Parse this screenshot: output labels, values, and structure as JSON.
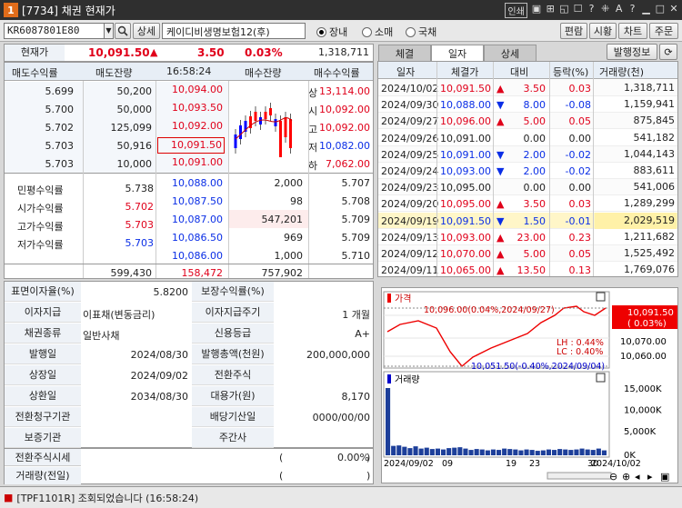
{
  "window": {
    "number": "1",
    "title": "[7734] 채권 현재가",
    "icons": [
      "인쇄",
      "▣",
      "⊞",
      "◱",
      "☐",
      "?",
      "⁜",
      "A",
      "?",
      "▁",
      "□",
      "✕"
    ]
  },
  "toolbar": {
    "code": "KR6087801E80",
    "detail": "상세",
    "bond_name": "케이디비생명보험12(후)",
    "radios": [
      "장내",
      "소매",
      "국채"
    ],
    "selected": 0,
    "buttons": [
      "편람",
      "시황",
      "차트",
      "주문"
    ]
  },
  "price_row": {
    "label": "현재가",
    "price": "10,091.50",
    "arrow": "▲",
    "change": "3.50",
    "pct": "0.03%",
    "volume": "1,318,711"
  },
  "quote": {
    "headers": [
      "매도수익률",
      "매도잔량",
      "16:58:24",
      "매수잔량",
      "매수수익률"
    ],
    "ask": [
      {
        "yield": "5.699",
        "qty": "50,200",
        "price": "10,094.00"
      },
      {
        "yield": "5.700",
        "qty": "50,000",
        "price": "10,093.50"
      },
      {
        "yield": "5.702",
        "qty": "125,099",
        "price": "10,092.00"
      },
      {
        "yield": "5.703",
        "qty": "50,916",
        "price": "10,091.50"
      },
      {
        "yield": "5.703",
        "qty": "10,000",
        "price": "10,091.00"
      }
    ],
    "bid": [
      {
        "price": "10,088.00",
        "qty": "2,000",
        "yield": "5.707"
      },
      {
        "price": "10,087.50",
        "qty": "98",
        "yield": "5.708"
      },
      {
        "price": "10,087.00",
        "qty": "547,201",
        "yield": "5.709"
      },
      {
        "price": "10,086.50",
        "qty": "969",
        "yield": "5.709"
      },
      {
        "price": "10,086.00",
        "qty": "1,000",
        "yield": "5.710"
      }
    ],
    "limits": [
      {
        "k": "상",
        "v": "13,114.00"
      },
      {
        "k": "시",
        "v": "10,092.00"
      },
      {
        "k": "고",
        "v": "10,092.00"
      },
      {
        "k": "저",
        "v": "10,082.00"
      },
      {
        "k": "하",
        "v": "7,062.00"
      }
    ],
    "stats": [
      {
        "k": "민평수익률",
        "v": "5.738"
      },
      {
        "k": "시가수익률",
        "v": "5.702"
      },
      {
        "k": "고가수익률",
        "v": "5.703"
      },
      {
        "k": "저가수익률",
        "v": "5.703"
      }
    ],
    "totals": {
      "ask_qty": "599,430",
      "diff": "158,472",
      "bid_qty": "757,902"
    }
  },
  "info": [
    [
      "표면이자율(%)",
      "5.8200",
      "보장수익률(%)",
      ""
    ],
    [
      "이자지급",
      "이표채(변동금리)",
      "이자지급주기",
      "1 개월"
    ],
    [
      "채권종류",
      "일반사채",
      "신용등급",
      "A+"
    ],
    [
      "발행일",
      "2024/08/30",
      "발행총액(천원)",
      "200,000,000"
    ],
    [
      "상장일",
      "2024/09/02",
      "전환주식",
      ""
    ],
    [
      "상환일",
      "2034/08/30",
      "대용가(원)",
      "8,170"
    ],
    [
      "전환청구기관",
      "",
      "배당기산일",
      "0000/00/00"
    ],
    [
      "보증기관",
      "",
      "주간사",
      ""
    ]
  ],
  "bottom": {
    "conv": "전환주식시세",
    "conv_paren": "(",
    "conv_pct": "0.00%",
    "conv_close": ")",
    "vol": "거래량(전일)",
    "vol_paren": "(",
    "vol_close": ")"
  },
  "right_tabs": {
    "tabs": [
      "체결",
      "일자",
      "상세"
    ],
    "active": 1,
    "btn": "발행정보"
  },
  "daily": {
    "headers": [
      "일자",
      "체결가",
      "대비",
      "등락(%)",
      "거래량(천)"
    ],
    "rows": [
      {
        "d": "2024/10/02",
        "p": "10,091.50",
        "pc": "red",
        "a": "▲",
        "c": "3.50",
        "r": "0.03",
        "v": "1,318,711"
      },
      {
        "d": "2024/09/30",
        "p": "10,088.00",
        "pc": "blue",
        "a": "▼",
        "c": "8.00",
        "r": "-0.08",
        "v": "1,159,941"
      },
      {
        "d": "2024/09/27",
        "p": "10,096.00",
        "pc": "red",
        "a": "▲",
        "c": "5.00",
        "r": "0.05",
        "v": "875,845"
      },
      {
        "d": "2024/09/26",
        "p": "10,091.00",
        "pc": "black",
        "a": "",
        "c": "0.00",
        "r": "0.00",
        "v": "541,182"
      },
      {
        "d": "2024/09/25",
        "p": "10,091.00",
        "pc": "blue",
        "a": "▼",
        "c": "2.00",
        "r": "-0.02",
        "v": "1,044,143"
      },
      {
        "d": "2024/09/24",
        "p": "10,093.00",
        "pc": "blue",
        "a": "▼",
        "c": "2.00",
        "r": "-0.02",
        "v": "883,611"
      },
      {
        "d": "2024/09/23",
        "p": "10,095.00",
        "pc": "black",
        "a": "",
        "c": "0.00",
        "r": "0.00",
        "v": "541,006"
      },
      {
        "d": "2024/09/20",
        "p": "10,095.00",
        "pc": "red",
        "a": "▲",
        "c": "3.50",
        "r": "0.03",
        "v": "1,289,299"
      },
      {
        "d": "2024/09/19",
        "p": "10,091.50",
        "pc": "blue",
        "a": "▼",
        "c": "1.50",
        "r": "-0.01",
        "v": "2,029,519"
      },
      {
        "d": "2024/09/13",
        "p": "10,093.00",
        "pc": "red",
        "a": "▲",
        "c": "23.00",
        "r": "0.23",
        "v": "1,211,682"
      },
      {
        "d": "2024/09/12",
        "p": "10,070.00",
        "pc": "red",
        "a": "▲",
        "c": "5.00",
        "r": "0.05",
        "v": "1,525,492"
      },
      {
        "d": "2024/09/11",
        "p": "10,065.00",
        "pc": "red",
        "a": "▲",
        "c": "13.50",
        "r": "0.13",
        "v": "1,769,076"
      }
    ]
  },
  "chart": {
    "price_title": "가격",
    "vol_title": "거래량",
    "high_ann": "10,096.00(0.04%,2024/09/27)",
    "low_ann": "10,051.50(-0.40%,2024/09/04)",
    "lh": "LH : 0.44%",
    "lc": "LC : 0.40%",
    "cur_price": "10,091.50",
    "cur_pct": "( 0.03%)",
    "yticks": [
      "10,070.00",
      "10,060.00"
    ],
    "vticks": [
      "15,000K",
      "10,000K",
      "5,000K",
      "0K"
    ],
    "xticks": [
      "2024/09/02",
      "09",
      "19",
      "23",
      "30",
      "2024/10/02"
    ],
    "vol_values": [
      15000,
      2100,
      2200,
      1900,
      1600,
      2000,
      1500,
      1700,
      1400,
      1500,
      1300,
      1600,
      1700,
      1800,
      1500,
      1200,
      1400,
      1300,
      1100,
      1300,
      1200,
      1500,
      1400,
      1300,
      1100,
      1300,
      1200,
      1000,
      1100,
      1300,
      1200,
      1400,
      1300,
      1200,
      1300,
      1500,
      1300,
      1200,
      1500,
      1100
    ]
  },
  "status": {
    "text": "[TPF1101R] 조회되었습니다 (16:58:24)"
  }
}
